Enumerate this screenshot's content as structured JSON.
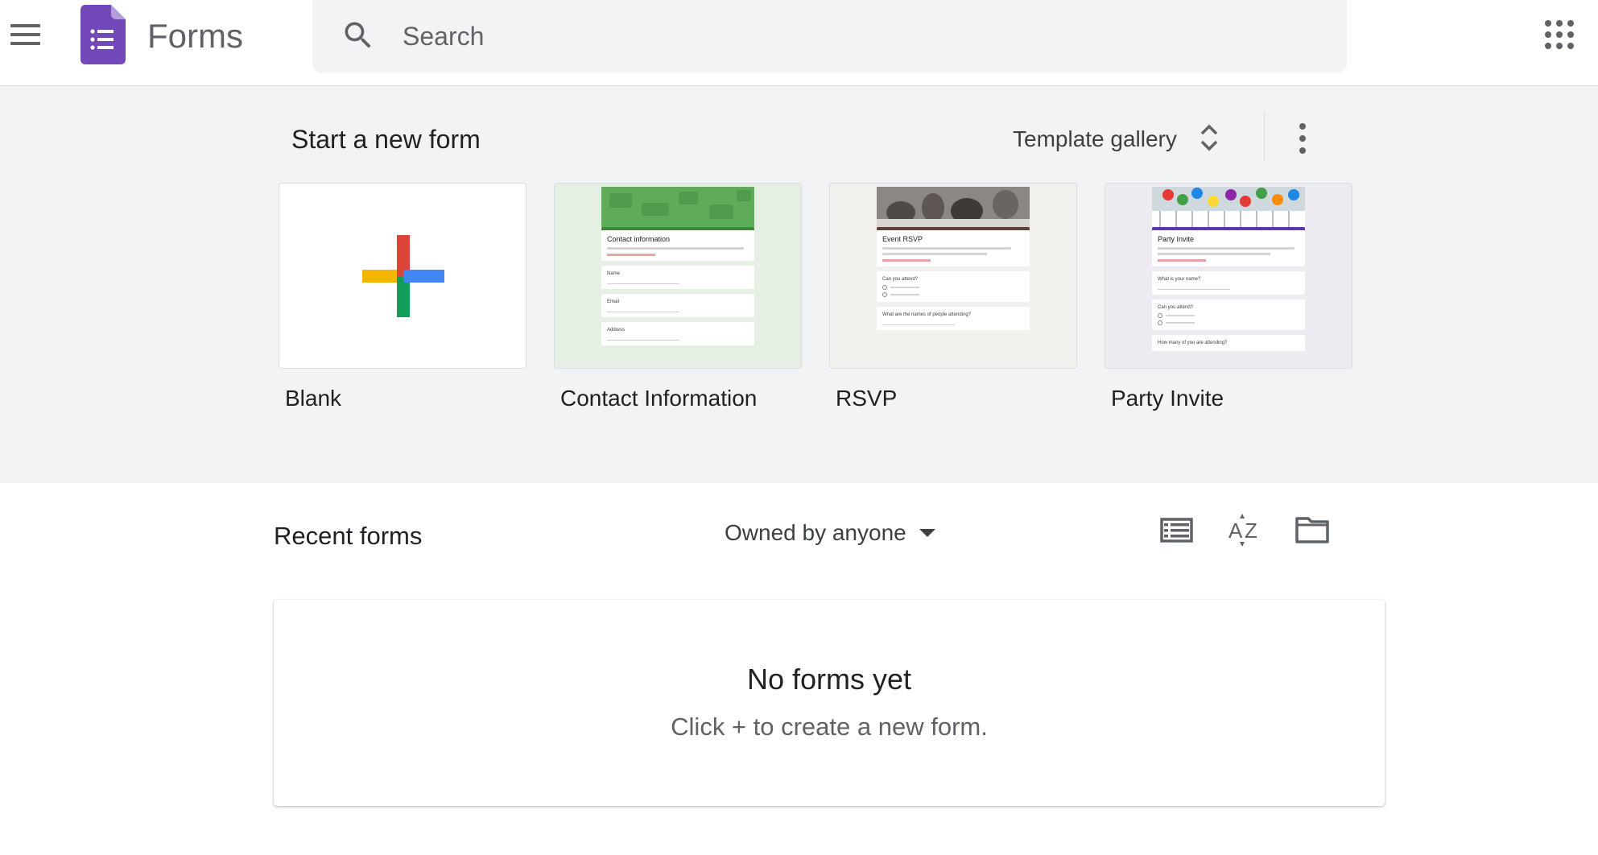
{
  "header": {
    "app_title": "Forms",
    "search_placeholder": "Search",
    "search_value": ""
  },
  "templates": {
    "section_title": "Start a new form",
    "gallery_label": "Template gallery",
    "items": [
      {
        "label": "Blank",
        "accent": "#4285f4"
      },
      {
        "label": "Contact Information",
        "accent": "#4caf50",
        "form_title": "Contact information",
        "questions": [
          "Name",
          "Email",
          "Address"
        ]
      },
      {
        "label": "RSVP",
        "accent": "#5d4037",
        "form_title": "Event RSVP",
        "questions": [
          "Can you attend?",
          "What are the names of people attending?"
        ]
      },
      {
        "label": "Party Invite",
        "accent": "#7e57c2",
        "form_title": "Party Invite",
        "questions": [
          "What is your name?",
          "Can you attend?",
          "How many of you are attending?"
        ]
      }
    ]
  },
  "recent": {
    "title": "Recent forms",
    "owner_filter": "Owned by anyone",
    "empty_title": "No forms yet",
    "empty_subtitle": "Click + to create a new form."
  },
  "colors": {
    "brand": "#7248b9",
    "template_bg": "#f1f3f4",
    "icon_gray": "#5f6368",
    "plus_red": "#db4437",
    "plus_blue": "#4285f4",
    "plus_green": "#0f9d58",
    "plus_yellow": "#f4b400"
  },
  "icons": {
    "menu": "hamburger-menu-icon",
    "logo": "forms-logo-icon",
    "search": "search-icon",
    "apps": "google-apps-icon",
    "unfold": "unfold-more-icon",
    "more": "more-vert-icon",
    "list_view": "list-view-icon",
    "sort": "sort-az-icon",
    "folder": "folder-icon"
  }
}
